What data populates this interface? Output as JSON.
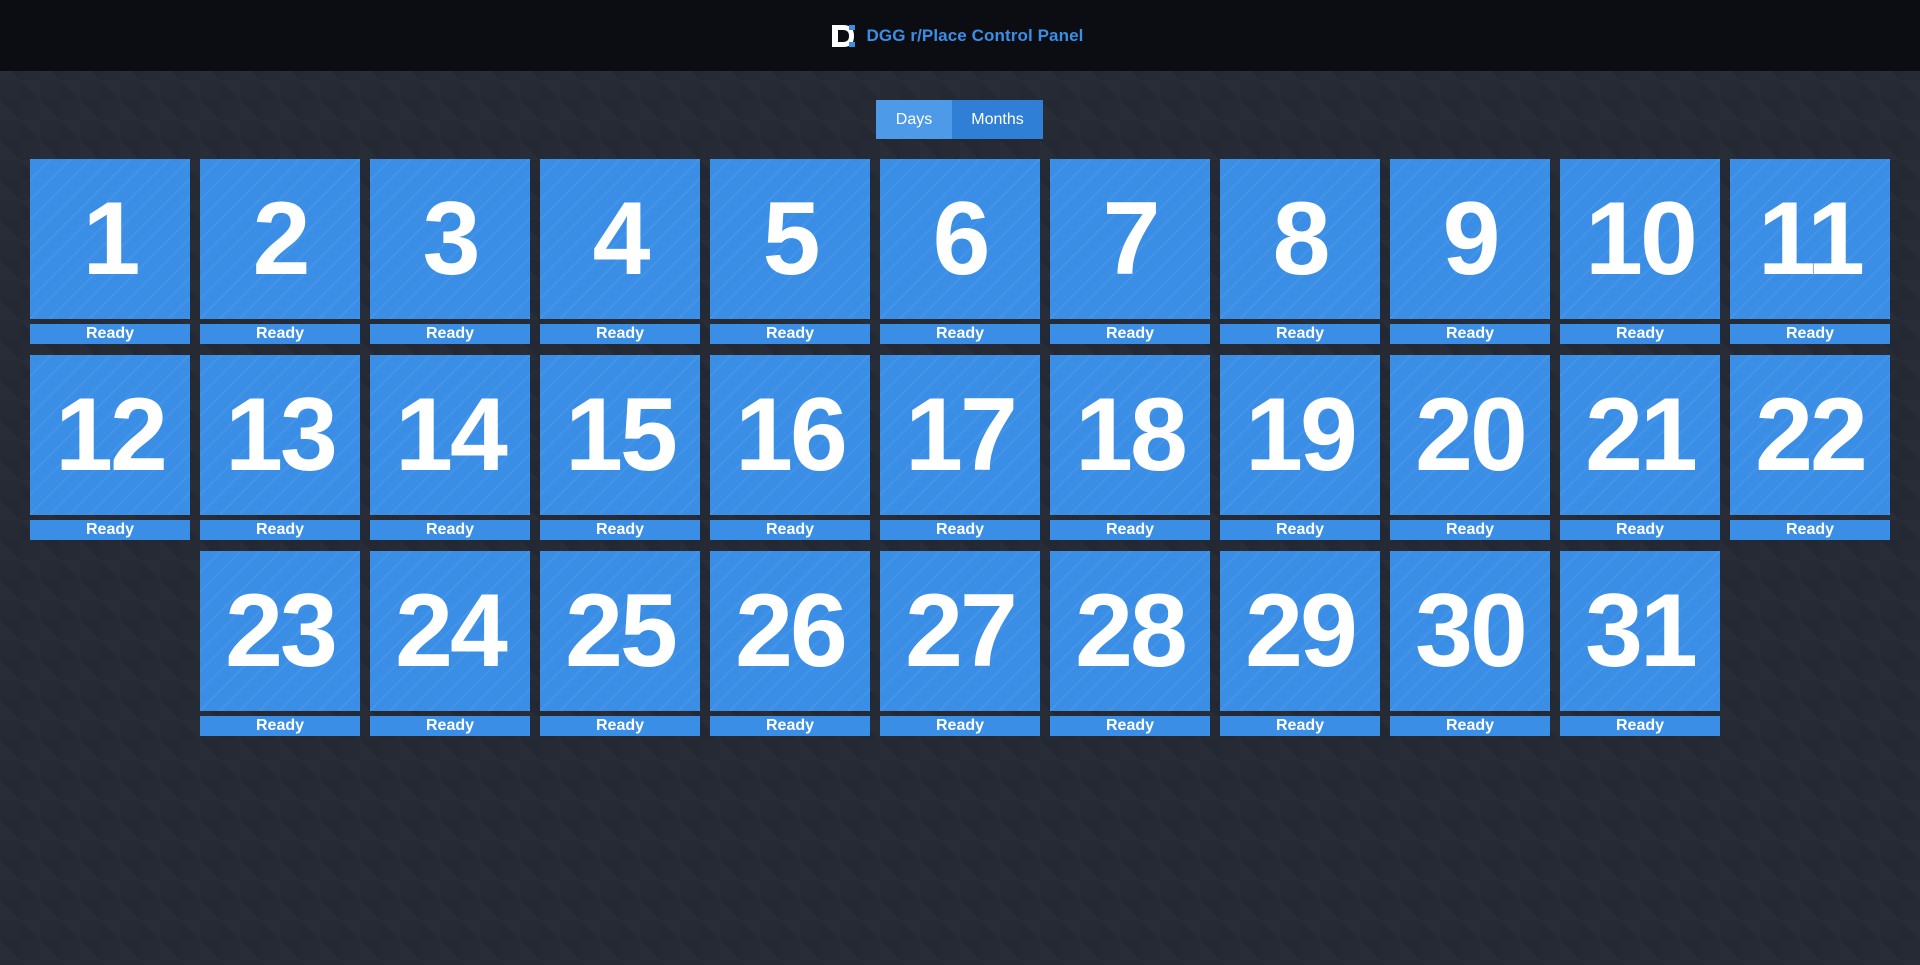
{
  "header": {
    "title": "DGG r/Place Control Panel",
    "logo_icon": "dgg-logo-icon"
  },
  "view_toggle": {
    "options": [
      "Days",
      "Months"
    ],
    "selected": "Days"
  },
  "colors": {
    "accent": "#3a8ee6",
    "header_bg": "#0b0d12",
    "page_bg": "#262a35"
  },
  "days": [
    {
      "day": "1",
      "status": "Ready"
    },
    {
      "day": "2",
      "status": "Ready"
    },
    {
      "day": "3",
      "status": "Ready"
    },
    {
      "day": "4",
      "status": "Ready"
    },
    {
      "day": "5",
      "status": "Ready"
    },
    {
      "day": "6",
      "status": "Ready"
    },
    {
      "day": "7",
      "status": "Ready"
    },
    {
      "day": "8",
      "status": "Ready"
    },
    {
      "day": "9",
      "status": "Ready"
    },
    {
      "day": "10",
      "status": "Ready"
    },
    {
      "day": "11",
      "status": "Ready"
    },
    {
      "day": "12",
      "status": "Ready"
    },
    {
      "day": "13",
      "status": "Ready"
    },
    {
      "day": "14",
      "status": "Ready"
    },
    {
      "day": "15",
      "status": "Ready"
    },
    {
      "day": "16",
      "status": "Ready"
    },
    {
      "day": "17",
      "status": "Ready"
    },
    {
      "day": "18",
      "status": "Ready"
    },
    {
      "day": "19",
      "status": "Ready"
    },
    {
      "day": "20",
      "status": "Ready"
    },
    {
      "day": "21",
      "status": "Ready"
    },
    {
      "day": "22",
      "status": "Ready"
    },
    {
      "day": "23",
      "status": "Ready"
    },
    {
      "day": "24",
      "status": "Ready"
    },
    {
      "day": "25",
      "status": "Ready"
    },
    {
      "day": "26",
      "status": "Ready"
    },
    {
      "day": "27",
      "status": "Ready"
    },
    {
      "day": "28",
      "status": "Ready"
    },
    {
      "day": "29",
      "status": "Ready"
    },
    {
      "day": "30",
      "status": "Ready"
    },
    {
      "day": "31",
      "status": "Ready"
    }
  ]
}
